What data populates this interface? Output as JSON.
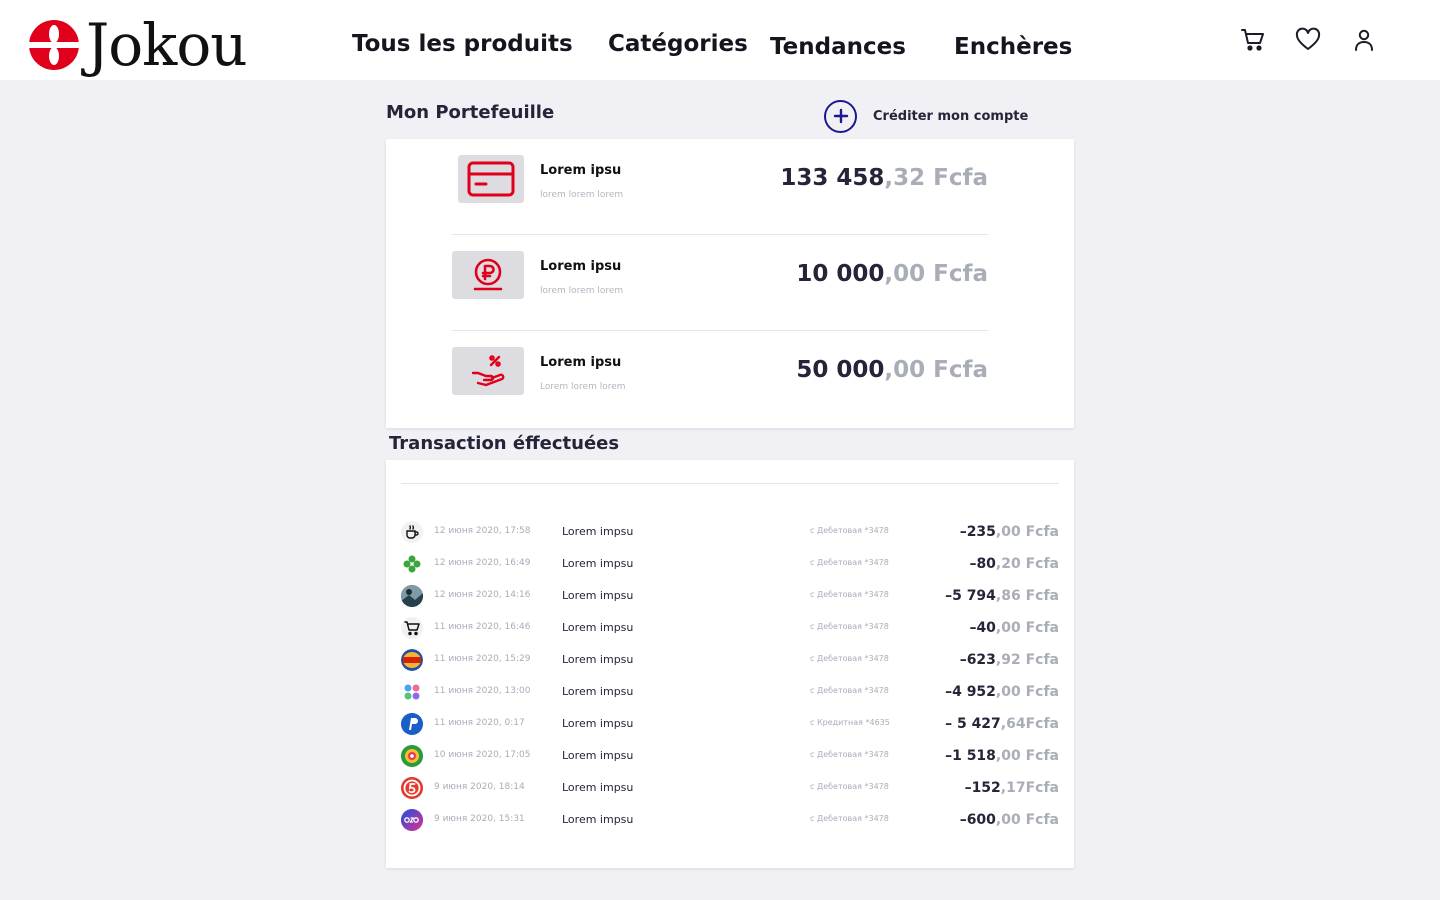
{
  "brand": {
    "name": "Jokou",
    "color": "#e0001b"
  },
  "nav": [
    {
      "label": "Tous les produits"
    },
    {
      "label": "Catégories"
    },
    {
      "label": "Tendances"
    },
    {
      "label": "Enchères"
    }
  ],
  "header_icons": [
    "cart-icon",
    "heart-icon",
    "user-icon"
  ],
  "wallet": {
    "title": "Mon Portefeuille",
    "credit_label": "Créditer mon compte",
    "accounts": [
      {
        "icon": "credit-card-icon",
        "name": "Lorem ipsu",
        "subtitle": "lorem lorem lorem",
        "amount_int": "133 458",
        "amount_dec": ",32 Fcfa"
      },
      {
        "icon": "coin-icon",
        "name": "Lorem ipsu",
        "subtitle": "lorem lorem lorem",
        "amount_int": "10 000",
        "amount_dec": ",00 Fcfa"
      },
      {
        "icon": "cashback-hand-icon",
        "name": "Lorem ipsu",
        "subtitle": "Lorem lorem lorem",
        "amount_int": "50 000",
        "amount_dec": ",00 Fcfa"
      }
    ]
  },
  "transactions": {
    "title": "Transaction éffectuées",
    "items": [
      {
        "icon": "coffee-icon",
        "date": "12 июня 2020, 17:58",
        "label": "Lorem impsu",
        "card": "с Дебетовая *3478",
        "amount_int": "–235",
        "amount_dec": ",00 Fcfa"
      },
      {
        "icon": "clover-icon",
        "date": "12 июня 2020, 16:49",
        "label": "Lorem impsu",
        "card": "с Дебетовая *3478",
        "amount_int": "–80",
        "amount_dec": ",20 Fcfa"
      },
      {
        "icon": "photo-avatar-icon",
        "date": "12 июня 2020, 14:16",
        "label": "Lorem impsu",
        "card": "с Дебетовая *3478",
        "amount_int": "–5 794",
        "amount_dec": ",86 Fcfa"
      },
      {
        "icon": "shopping-cart-icon",
        "date": "11 июня 2020, 16:46",
        "label": "Lorem impsu",
        "card": "с Дебетовая *3478",
        "amount_int": "–40",
        "amount_dec": ",00 Fcfa"
      },
      {
        "icon": "burger-king-logo-icon",
        "date": "11 июня 2020, 15:29",
        "label": "Lorem impsu",
        "card": "с Дебетовая *3478",
        "amount_int": "–623",
        "amount_dec": ",92 Fcfa"
      },
      {
        "icon": "four-dots-logo-icon",
        "date": "11 июня 2020, 13:00",
        "label": "Lorem impsu",
        "card": "с Дебетовая *3478",
        "amount_int": "–4 952",
        "amount_dec": ",00 Fcfa"
      },
      {
        "icon": "paypal-logo-icon",
        "date": "11 июня 2020, 0:17",
        "label": "Lorem impsu",
        "card": "с Кредитная *4635",
        "amount_int": "– 5 427",
        "amount_dec": ",64Fcfa"
      },
      {
        "icon": "colorful-circle-logo-icon",
        "date": "10 июня 2020, 17:05",
        "label": "Lorem impsu",
        "card": "с Дебетовая *3478",
        "amount_int": "–1 518",
        "amount_dec": ",00 Fcfa"
      },
      {
        "icon": "five-logo-icon",
        "date": "9 июня 2020, 18:14",
        "label": "Lorem impsu",
        "card": "с Дебетовая *3478",
        "amount_int": "–152",
        "amount_dec": ",17Fcfa"
      },
      {
        "icon": "ozon-logo-icon",
        "date": "9 июня 2020, 15:31",
        "label": "Lorem impsu",
        "card": "с Дебетовая *3478",
        "amount_int": "–600",
        "amount_dec": ",00 Fcfa"
      }
    ]
  }
}
